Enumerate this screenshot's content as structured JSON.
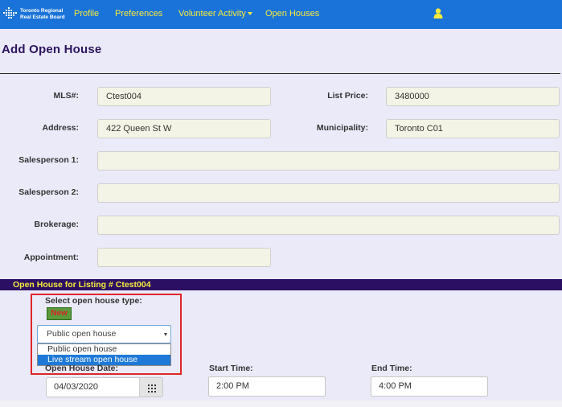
{
  "nav": {
    "logo_line1": "Toronto Regional",
    "logo_line2": "Real Estate Board",
    "profile": "Profile",
    "preferences": "Preferences",
    "volunteer_activity": "Volunteer Activity",
    "open_houses": "Open Houses",
    "user_icon": "user-icon"
  },
  "page": {
    "title": "Add Open House"
  },
  "form": {
    "mls_label": "MLS#:",
    "mls_value": "Ctest004",
    "list_price_label": "List Price:",
    "list_price_value": "3480000",
    "address_label": "Address:",
    "address_value": "422 Queen St W",
    "municipality_label": "Municipality:",
    "municipality_value": "Toronto C01",
    "salesperson1_label": "Salesperson 1:",
    "salesperson1_value": "",
    "salesperson2_label": "Salesperson 2:",
    "salesperson2_value": "",
    "brokerage_label": "Brokerage:",
    "brokerage_value": "",
    "appointment_label": "Appointment:",
    "appointment_value": ""
  },
  "open_house": {
    "section_title": "Open House for Listing # Ctest004",
    "type_label": "Select open house type:",
    "new_badge": "New",
    "selected_type": "Public open house",
    "type_options": [
      "Public open house",
      "Live stream open house"
    ],
    "date_label": "Open House Date:",
    "date_value": "04/03/2020",
    "start_time_label": "Start Time:",
    "start_time_value": "2:00 PM",
    "end_time_label": "End Time:",
    "end_time_value": "4:00 PM"
  },
  "colors": {
    "nav_bg": "#1a73d9",
    "nav_text": "#f6ea3c",
    "section_bg": "#2a0f62",
    "highlight_border": "#e0262a",
    "selected_option_bg": "#1e79d8"
  },
  "icons": {
    "calendar": "calendar-grid-icon",
    "dropdown": "chevron-down-icon",
    "logo": "treb-logo-icon"
  }
}
